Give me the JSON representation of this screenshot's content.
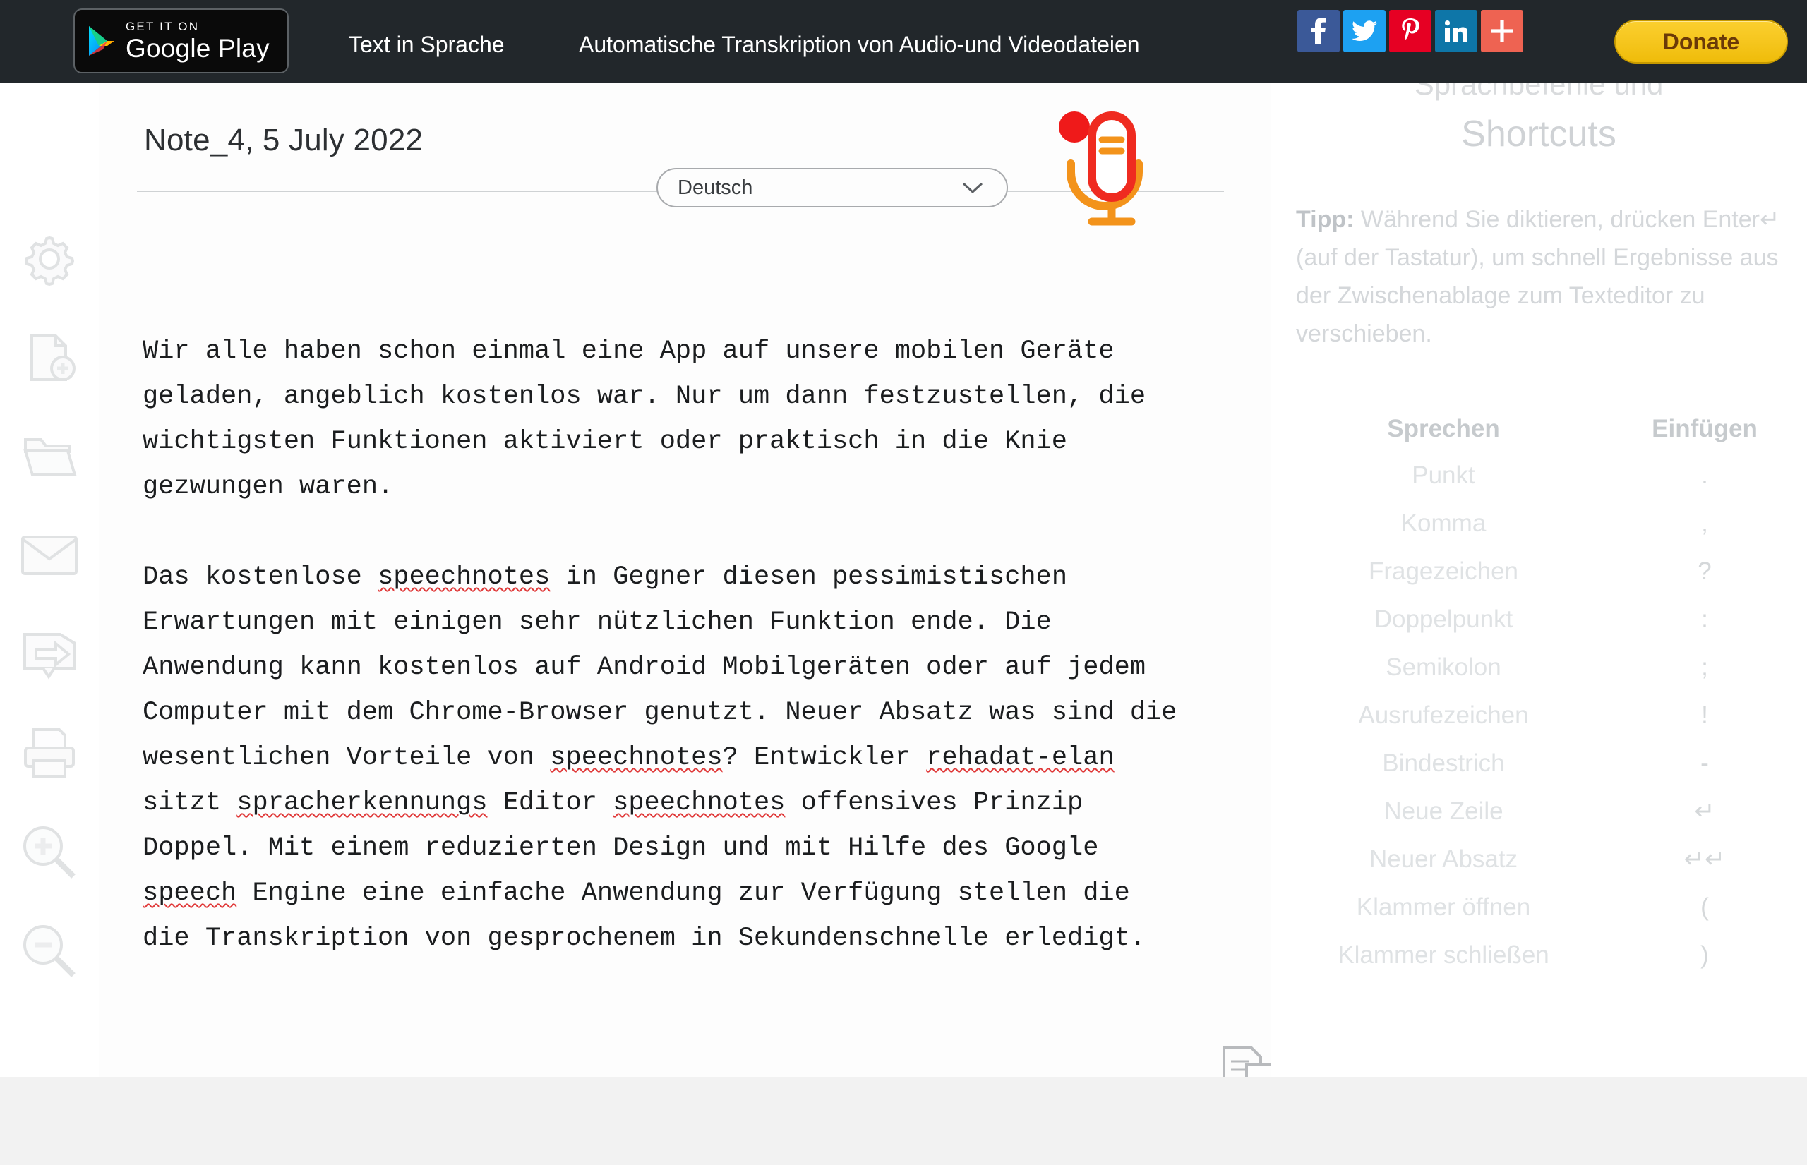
{
  "topbar": {
    "google_play": {
      "line1": "GET IT ON",
      "line2": "Google Play",
      "icon": "google-play-triangle-icon"
    },
    "nav": [
      {
        "id": "text-to-speech",
        "label": "Text in Sprache"
      },
      {
        "id": "transcription",
        "label": "Automatische Transkription von Audio-und Videodateien"
      }
    ],
    "social": [
      {
        "id": "facebook",
        "icon": "facebook-icon",
        "glyph": "f",
        "color": "#3b5998"
      },
      {
        "id": "twitter",
        "icon": "twitter-icon",
        "glyph": "t",
        "color": "#1da1f2"
      },
      {
        "id": "pinterest",
        "icon": "pinterest-icon",
        "glyph": "P",
        "color": "#e60023"
      },
      {
        "id": "linkedin",
        "icon": "linkedin-icon",
        "glyph": "in",
        "color": "#0e76a8"
      },
      {
        "id": "share-more",
        "icon": "plus-share-icon",
        "glyph": "+",
        "color": "#ee6352"
      }
    ],
    "donate_label": "Donate",
    "donate_color": "#f5c51c",
    "background_color": "#22272b"
  },
  "left_rail": {
    "items": [
      {
        "id": "settings",
        "icon": "gear-icon",
        "tooltip": "Settings"
      },
      {
        "id": "new-note",
        "icon": "new-document-plus-icon",
        "tooltip": "New note"
      },
      {
        "id": "open-folder",
        "icon": "open-folder-icon",
        "tooltip": "Open"
      },
      {
        "id": "email",
        "icon": "envelope-icon",
        "tooltip": "Email"
      },
      {
        "id": "export",
        "icon": "export-arrow-icon",
        "tooltip": "Export"
      },
      {
        "id": "print",
        "icon": "printer-icon",
        "tooltip": "Print"
      },
      {
        "id": "zoom-in",
        "icon": "magnifier-plus-icon",
        "tooltip": "Zoom in"
      },
      {
        "id": "zoom-out",
        "icon": "magnifier-minus-icon",
        "tooltip": "Zoom out"
      }
    ]
  },
  "editor": {
    "note_title": "Note_4, 5 July 2022",
    "language_selected": "Deutsch",
    "language_options": [
      "Deutsch"
    ],
    "chevron_icon": "chevron-down-icon",
    "mic_icon": "microphone-icon",
    "mic_recording_dot_color": "#ef1a1a",
    "mic_body_color": "#ef2b20",
    "mic_stand_color": "#f3931b",
    "copy_icon": "copy-pages-icon",
    "spellcheck_underline_color": "#e03a3a",
    "paragraph_1": "Wir alle haben schon einmal eine App auf unsere mobilen Geräte geladen, angeblich kostenlos war. Nur um dann festzustellen, die wichtigsten Funktionen aktiviert oder praktisch in die Knie gezwungen waren.",
    "paragraph_2_parts": [
      {
        "text": "Das kostenlose ",
        "misspelled": false
      },
      {
        "text": "speechnotes",
        "misspelled": true
      },
      {
        "text": " in Gegner diesen pessimistischen Erwartungen mit einigen sehr nützlichen Funktion ende. Die Anwendung kann kostenlos auf Android Mobilgeräten oder auf jedem Computer mit dem Chrome-Browser genutzt. Neuer Absatz was sind die wesentlichen Vorteile von ",
        "misspelled": false
      },
      {
        "text": "speechnotes",
        "misspelled": true
      },
      {
        "text": "? Entwickler ",
        "misspelled": false
      },
      {
        "text": "rehadat-elan",
        "misspelled": true
      },
      {
        "text": " sitzt ",
        "misspelled": false
      },
      {
        "text": "spracherkennungs",
        "misspelled": true
      },
      {
        "text": " Editor ",
        "misspelled": false
      },
      {
        "text": "speechnotes",
        "misspelled": true
      },
      {
        "text": " offensives Prinzip Doppel. Mit einem reduzierten Design und mit Hilfe des Google ",
        "misspelled": false
      },
      {
        "text": "speech",
        "misspelled": true
      },
      {
        "text": " Engine eine einfache Anwendung zur Verfügung stellen die die Transkription von gesprochenem in Sekundenschnelle erledigt.",
        "misspelled": false
      }
    ]
  },
  "right_panel": {
    "heading_cut_off": "Sprachbefehle und",
    "heading": "Shortcuts",
    "tip_label": "Tipp:",
    "tip_text": " Während Sie diktieren, drücken Enter↵ (auf der Tastatur), um schnell Ergebnisse aus der Zwischenablage zum Texteditor zu verschieben.",
    "table": {
      "headers": [
        "Sprechen",
        "Einfügen"
      ],
      "rows": [
        {
          "say": "Punkt",
          "insert": "."
        },
        {
          "say": "Komma",
          "insert": ","
        },
        {
          "say": "Fragezeichen",
          "insert": "?"
        },
        {
          "say": "Doppelpunkt",
          "insert": ":"
        },
        {
          "say": "Semikolon",
          "insert": ";"
        },
        {
          "say": "Ausrufezeichen",
          "insert": "!"
        },
        {
          "say": "Bindestrich",
          "insert": "-"
        },
        {
          "say": "Neue Zeile",
          "insert": "↵"
        },
        {
          "say": "Neuer Absatz",
          "insert": "↵↵"
        },
        {
          "say": "Klammer öffnen",
          "insert": "("
        },
        {
          "say": "Klammer schließen",
          "insert": ")"
        }
      ]
    }
  }
}
